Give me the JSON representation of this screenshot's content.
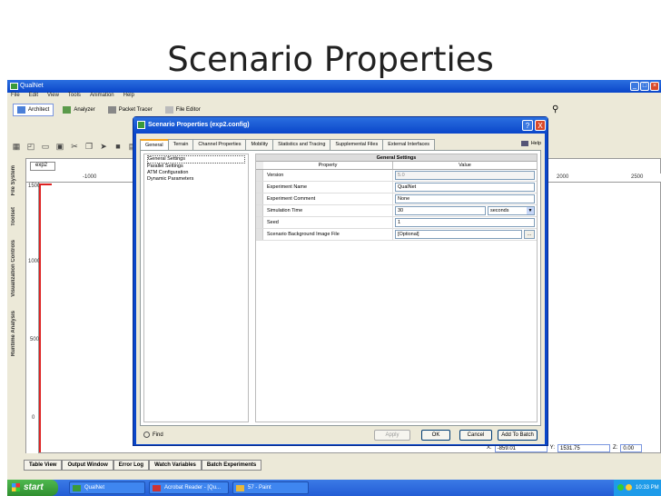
{
  "slide": {
    "title": "Scenario Properties"
  },
  "app": {
    "title": "QualNet",
    "menu": [
      "File",
      "Edit",
      "View",
      "Tools",
      "Animation",
      "Help"
    ],
    "modes": [
      "Architect",
      "Analyzer",
      "Packet Tracer",
      "File Editor"
    ],
    "canvas_tab": "exp2",
    "sidebar_tabs": [
      "File System",
      "Toolset",
      "Visualization Controls",
      "Runtime Analysis"
    ],
    "hruler": [
      "-1000",
      "2000",
      "2500"
    ],
    "vruler": [
      "1500",
      "1000",
      "500",
      "0"
    ],
    "bottom_tabs": [
      "Table View",
      "Output Window",
      "Error Log",
      "Watch Variables",
      "Batch Experiments"
    ],
    "coords": {
      "x_label": "X:",
      "x_value": "-859.01",
      "y_label": "Y:",
      "y_value": "1531.75",
      "z_label": "Z:",
      "z_value": "0.00"
    }
  },
  "dialog": {
    "title": "Scenario Properties (exp2.config)",
    "help_btn": "?",
    "close_btn": "X",
    "help_link": "Help",
    "tabs": [
      "General",
      "Terrain",
      "Channel Properties",
      "Mobility",
      "Statistics and Tracing",
      "Supplemental Files",
      "External Interfaces"
    ],
    "tree": [
      "General Settings",
      "Parallel Settings",
      "ATM Configuration",
      "Dynamic Parameters"
    ],
    "grid": {
      "title": "General Settings",
      "col_property": "Property",
      "col_value": "Value",
      "rows": [
        {
          "property": "Version",
          "value": "5.0"
        },
        {
          "property": "Experiment Name",
          "value": "QualNet"
        },
        {
          "property": "Experiment Comment",
          "value": "None"
        },
        {
          "property": "Simulation Time",
          "value": "30",
          "unit": "seconds"
        },
        {
          "property": "Seed",
          "value": "1"
        },
        {
          "property": "Scenario Background Image File",
          "value": "[Optional]",
          "browse": "..."
        }
      ]
    },
    "find": "Find",
    "buttons": {
      "apply": "Apply",
      "ok": "OK",
      "cancel": "Cancel",
      "add_to_batch": "Add To Batch"
    }
  },
  "taskbar": {
    "start": "start",
    "tasks": [
      "QualNet",
      "Acrobat Reader - [Qu...",
      "57 - Paint"
    ],
    "clock": "10:33 PM"
  }
}
